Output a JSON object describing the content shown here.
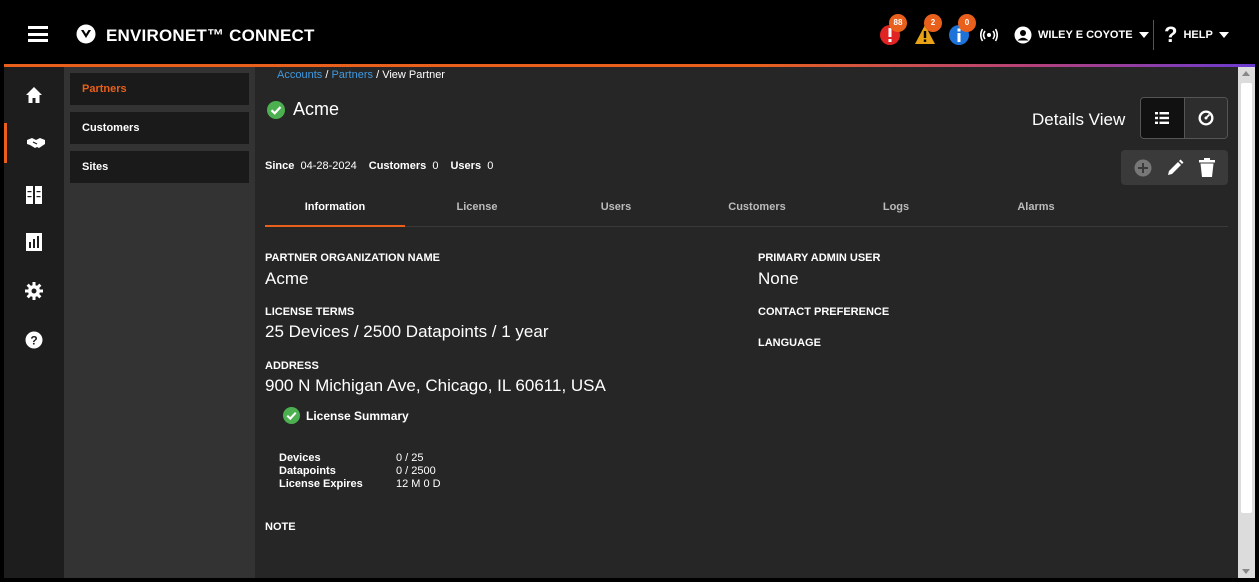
{
  "header": {
    "brand": "ENVIRONET™ CONNECT",
    "alerts": [
      {
        "type": "critical",
        "icon": "critical-alert-icon",
        "count": "88",
        "color": "#e02424"
      },
      {
        "type": "warning",
        "icon": "warning-alert-icon",
        "count": "2",
        "color": "#e8a317"
      },
      {
        "type": "info",
        "icon": "info-alert-icon",
        "count": "0",
        "color": "#1e73d8"
      }
    ],
    "user": "WILEY E COYOTE",
    "help": "HELP"
  },
  "sidebar": {
    "icons": [
      "home-icon",
      "handshake-icon",
      "dashboard-icon",
      "report-icon",
      "settings-icon",
      "help-icon"
    ]
  },
  "subnav": {
    "items": [
      {
        "label": "Partners",
        "active": true
      },
      {
        "label": "Customers",
        "active": false
      },
      {
        "label": "Sites",
        "active": false
      }
    ]
  },
  "breadcrumb": {
    "items": [
      "Accounts",
      "Partners",
      "View Partner"
    ]
  },
  "partner": {
    "name": "Acme",
    "since_label": "Since",
    "since": "04-28-2024",
    "customers_label": "Customers",
    "customers": "0",
    "users_label": "Users",
    "users": "0"
  },
  "view": {
    "label": "Details View"
  },
  "tabs": [
    "Information",
    "License",
    "Users",
    "Customers",
    "Logs",
    "Alarms"
  ],
  "info": {
    "org_name_label": "PARTNER ORGANIZATION NAME",
    "org_name": "Acme",
    "license_terms_label": "LICENSE TERMS",
    "license_terms": "25 Devices / 2500 Datapoints / 1 year",
    "address_label": "ADDRESS",
    "address": "900 N Michigan Ave, Chicago, IL 60611, USA",
    "primary_admin_label": "PRIMARY ADMIN USER",
    "primary_admin": "None",
    "contact_pref_label": "CONTACT PREFERENCE",
    "language_label": "LANGUAGE",
    "note_label": "NOTE"
  },
  "license_summary": {
    "title": "License Summary",
    "rows": [
      {
        "key": "Devices",
        "value": "0 / 25"
      },
      {
        "key": "Datapoints",
        "value": "0 / 2500"
      },
      {
        "key": "License Expires",
        "value": "12 M 0 D"
      }
    ]
  },
  "colors": {
    "accent": "#e8601c",
    "link": "#3f9ae0",
    "success": "#4caf50"
  }
}
